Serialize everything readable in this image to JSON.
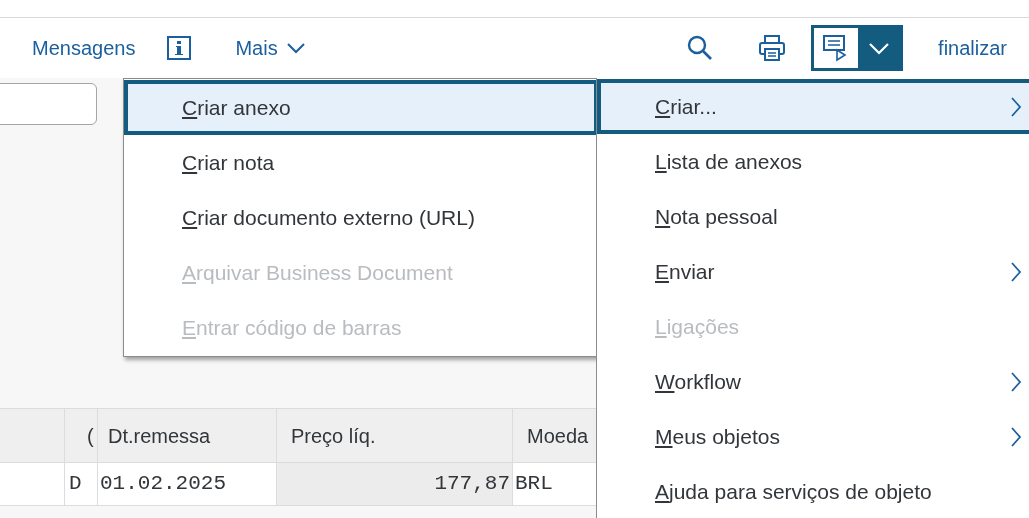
{
  "toolbar": {
    "links": [
      "Mensagens"
    ],
    "more": "Mais",
    "finish": "finalizar"
  },
  "table": {
    "columns": [
      "(",
      "Dt.remessa",
      "Preço líq.",
      "Moeda"
    ],
    "rows": [
      [
        "D",
        "01.02.2025",
        "177,87",
        "BRL"
      ]
    ]
  },
  "submenu": [
    {
      "label": "Criar anexo",
      "selected": true,
      "disabled": false
    },
    {
      "label": "Criar nota",
      "selected": false,
      "disabled": false
    },
    {
      "label": "Criar documento externo (URL)",
      "selected": false,
      "disabled": false
    },
    {
      "label": "Arquivar Business Document",
      "selected": false,
      "disabled": true
    },
    {
      "label": "Entrar código de barras",
      "selected": false,
      "disabled": true
    }
  ],
  "menu": [
    {
      "label": "Criar...",
      "selected": true,
      "disabled": false,
      "has_submenu": true
    },
    {
      "label": "Lista de anexos",
      "selected": false,
      "disabled": false,
      "has_submenu": false
    },
    {
      "label": "Nota pessoal",
      "selected": false,
      "disabled": false,
      "has_submenu": false
    },
    {
      "label": "Enviar",
      "selected": false,
      "disabled": false,
      "has_submenu": true
    },
    {
      "label": "Ligações",
      "selected": false,
      "disabled": true,
      "has_submenu": false
    },
    {
      "label": "Workflow",
      "selected": false,
      "disabled": false,
      "has_submenu": true
    },
    {
      "label": "Meus objetos",
      "selected": false,
      "disabled": false,
      "has_submenu": true
    },
    {
      "label": "Ajuda para serviços de objeto",
      "selected": false,
      "disabled": false,
      "has_submenu": false
    }
  ]
}
